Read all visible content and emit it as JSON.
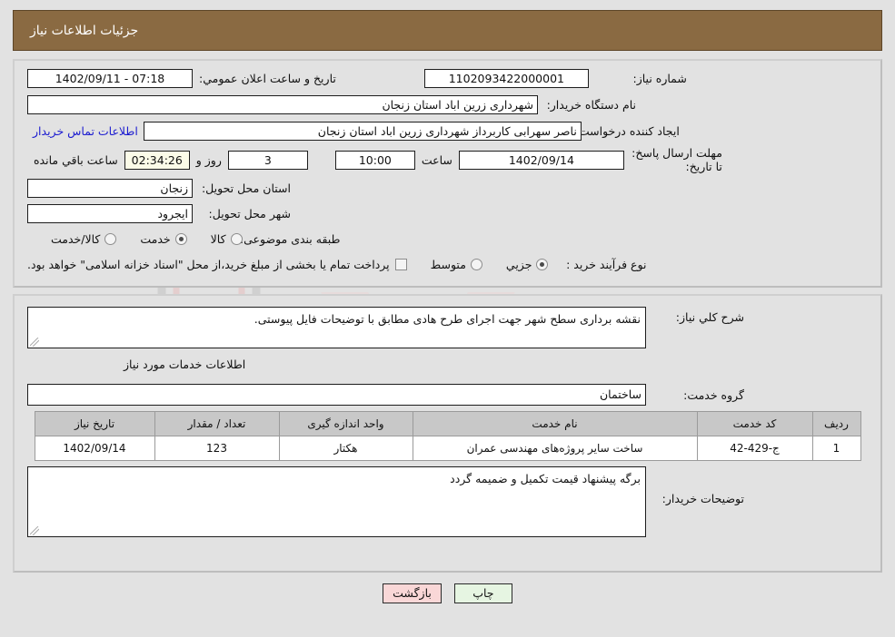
{
  "header": {
    "title": "جزئیات اطلاعات نیاز"
  },
  "top": {
    "need_number_label": "شماره نیاز:",
    "need_number_value": "1102093422000001",
    "announce_label": "تاریخ و ساعت اعلان عمومي:",
    "announce_value": "07:18 - 1402/09/11",
    "buyer_org_label": "نام دستگاه خریدار:",
    "buyer_org_value": "شهرداری زرین اباد استان زنجان",
    "creator_label": "ایجاد کننده درخواست:",
    "creator_value": "ناصر سهرابی کاربرداز شهرداری زرین اباد استان زنجان",
    "contact_link": "اطلاعات تماس خریدار",
    "deadline_label": "مهلت ارسال پاسخ: تا تاریخ:",
    "deadline_date": "1402/09/14",
    "hour_label": "ساعت",
    "deadline_time": "10:00",
    "days_left": "3",
    "days_label": "روز و",
    "countdown": "02:34:26",
    "remaining_label": "ساعت باقي مانده",
    "province_label": "استان محل تحویل:",
    "province_value": "زنجان",
    "city_label": "شهر محل تحویل:",
    "city_value": "ایجرود",
    "category_label": "طبقه بندی موضوعی:",
    "category_options": [
      {
        "label": "کالا",
        "selected": false
      },
      {
        "label": "خدمت",
        "selected": true
      },
      {
        "label": "کالا/خدمت",
        "selected": false
      }
    ],
    "process_label": "نوع فرآیند خرید :",
    "process_options": [
      {
        "label": "جزیي",
        "selected": true
      },
      {
        "label": "متوسط",
        "selected": false
      }
    ],
    "treasury_checkbox_label": "پرداخت تمام یا بخشی از مبلغ خرید،از محل \"اسناد خزانه اسلامی\" خواهد بود.",
    "treasury_checked": false
  },
  "mid": {
    "overview_label": "شرح کلي نیاز:",
    "overview_value": "نقشه برداری سطح شهر جهت اجرای طرح هادی مطابق با توضیحات فایل پیوستی.",
    "services_section_title": "اطلاعات خدمات مورد نیاز",
    "service_group_label": "گروه خدمت:",
    "service_group_value": "ساختمان",
    "table": {
      "headers": [
        "ردیف",
        "کد خدمت",
        "نام خدمت",
        "واحد اندازه گیری",
        "تعداد / مقدار",
        "تاریخ نیاز"
      ],
      "rows": [
        [
          "1",
          "ج-429-42",
          "ساخت سایر پروژه‌های مهندسی عمران",
          "هکتار",
          "123",
          "1402/09/14"
        ]
      ]
    },
    "buyer_notes_label": "توضیحات خریدار:",
    "buyer_notes_value": "برگه پیشنهاد قیمت تکمیل و ضمیمه گردد"
  },
  "footer": {
    "print_label": "چاپ",
    "back_label": "بازگشت"
  },
  "watermark": {
    "text": "AriaTender.net"
  },
  "colors": {
    "header_bg": "#8a6a42",
    "page_bg": "#e2e2e2",
    "link": "#1b1bd0",
    "back_btn": "#f9d7d7",
    "print_btn": "#e6f5e2",
    "table_header": "#c8c8c8"
  }
}
